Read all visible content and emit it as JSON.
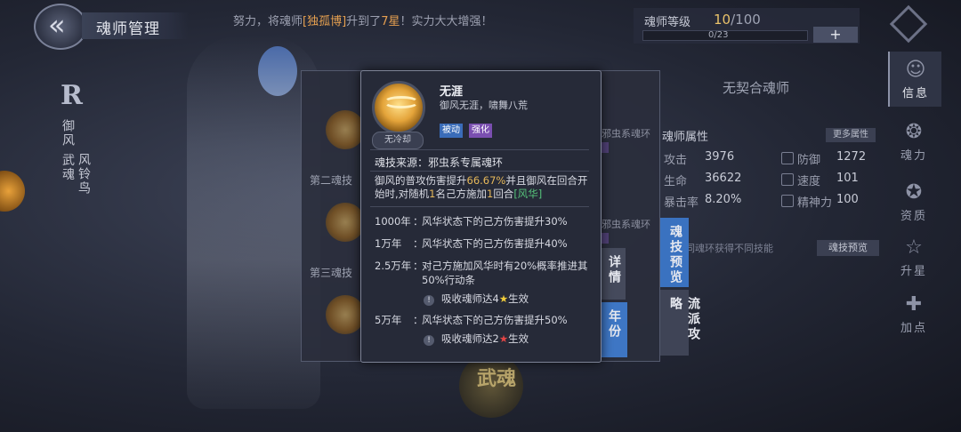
{
  "header": {
    "title": "魂师管理",
    "marquee": {
      "pre": "努力，将魂师",
      "name": "[独孤博]",
      "mid": "升到了",
      "level": "7星",
      "post": "！实力大大增强！"
    },
    "level_label": "魂师等级",
    "level_current": "10",
    "level_max": "/100",
    "exp": "0/23",
    "add_label": "+"
  },
  "character": {
    "rank": "R",
    "title": "御风 武魂",
    "wuhun": "风铃鸟"
  },
  "right_nav": [
    {
      "label": "信息",
      "icon": "info-icon"
    },
    {
      "label": "魂力",
      "icon": "soul-power-icon"
    },
    {
      "label": "资质",
      "icon": "aptitude-icon"
    },
    {
      "label": "升星",
      "icon": "star-up-icon"
    },
    {
      "label": "加点",
      "icon": "add-points-icon"
    }
  ],
  "back_panel": {
    "slot2": "第二魂技",
    "slot3": "第三魂技",
    "ring_label_1": "邪虫系魂环",
    "ring_label_2": "邪虫系魂环"
  },
  "tabs": {
    "details": "详情",
    "year": "年份",
    "skill_preview": "魂技预览",
    "school": "流派攻略"
  },
  "attributes": {
    "no_contract": "无契合魂师",
    "title": "魂师属性",
    "more": "更多属性",
    "items": [
      {
        "name": "攻击",
        "value": "3976"
      },
      {
        "name": "防御",
        "value": "1272"
      },
      {
        "name": "生命",
        "value": "36622"
      },
      {
        "name": "速度",
        "value": "101"
      },
      {
        "name": "暴击率",
        "value": "8.20%"
      },
      {
        "name": "精神力",
        "value": "100"
      }
    ],
    "hint": "同魂环获得不同技能",
    "skill_preview_btn": "魂技预览"
  },
  "bottom_emblem": "武魂",
  "tooltip": {
    "name": "无涯",
    "subtitle": "御风无涯，啸舞八荒",
    "cooldown": "无冷却",
    "tags": [
      "被动",
      "强化"
    ],
    "source": "魂技来源：邪虫系专属魂环",
    "desc": {
      "p1": "御风的普攻伤害提升",
      "v1": "66.67%",
      "p2": "并且御风在回合开始时,对随机",
      "v2": "1",
      "p3": "名己方施加",
      "v3": "1",
      "p4": "回合",
      "buff": "[风华]"
    },
    "years": [
      {
        "year": "1000年",
        "desc": "风华状态下的己方伤害提升30%"
      },
      {
        "year": "1万年",
        "desc": "风华状态下的己方伤害提升40%"
      },
      {
        "year": "2.5万年",
        "desc": "对己方施加风华时有20%概率推进其50%行动条",
        "cond_pre": "吸收魂师达4",
        "cond_post": "生效",
        "star": "★"
      },
      {
        "year": "5万年",
        "desc": "风华状态下的己方伤害提升50%",
        "cond_pre": "吸收魂师达2",
        "cond_post": "生效",
        "star": "★"
      }
    ],
    "colon": "："
  },
  "colors": {
    "accent_blue": "#3a72c0",
    "gold": "#e6b85a",
    "green": "#56c27a",
    "tag_passive": "#3a6cb8",
    "tag_enhance": "#7a4fb0"
  }
}
